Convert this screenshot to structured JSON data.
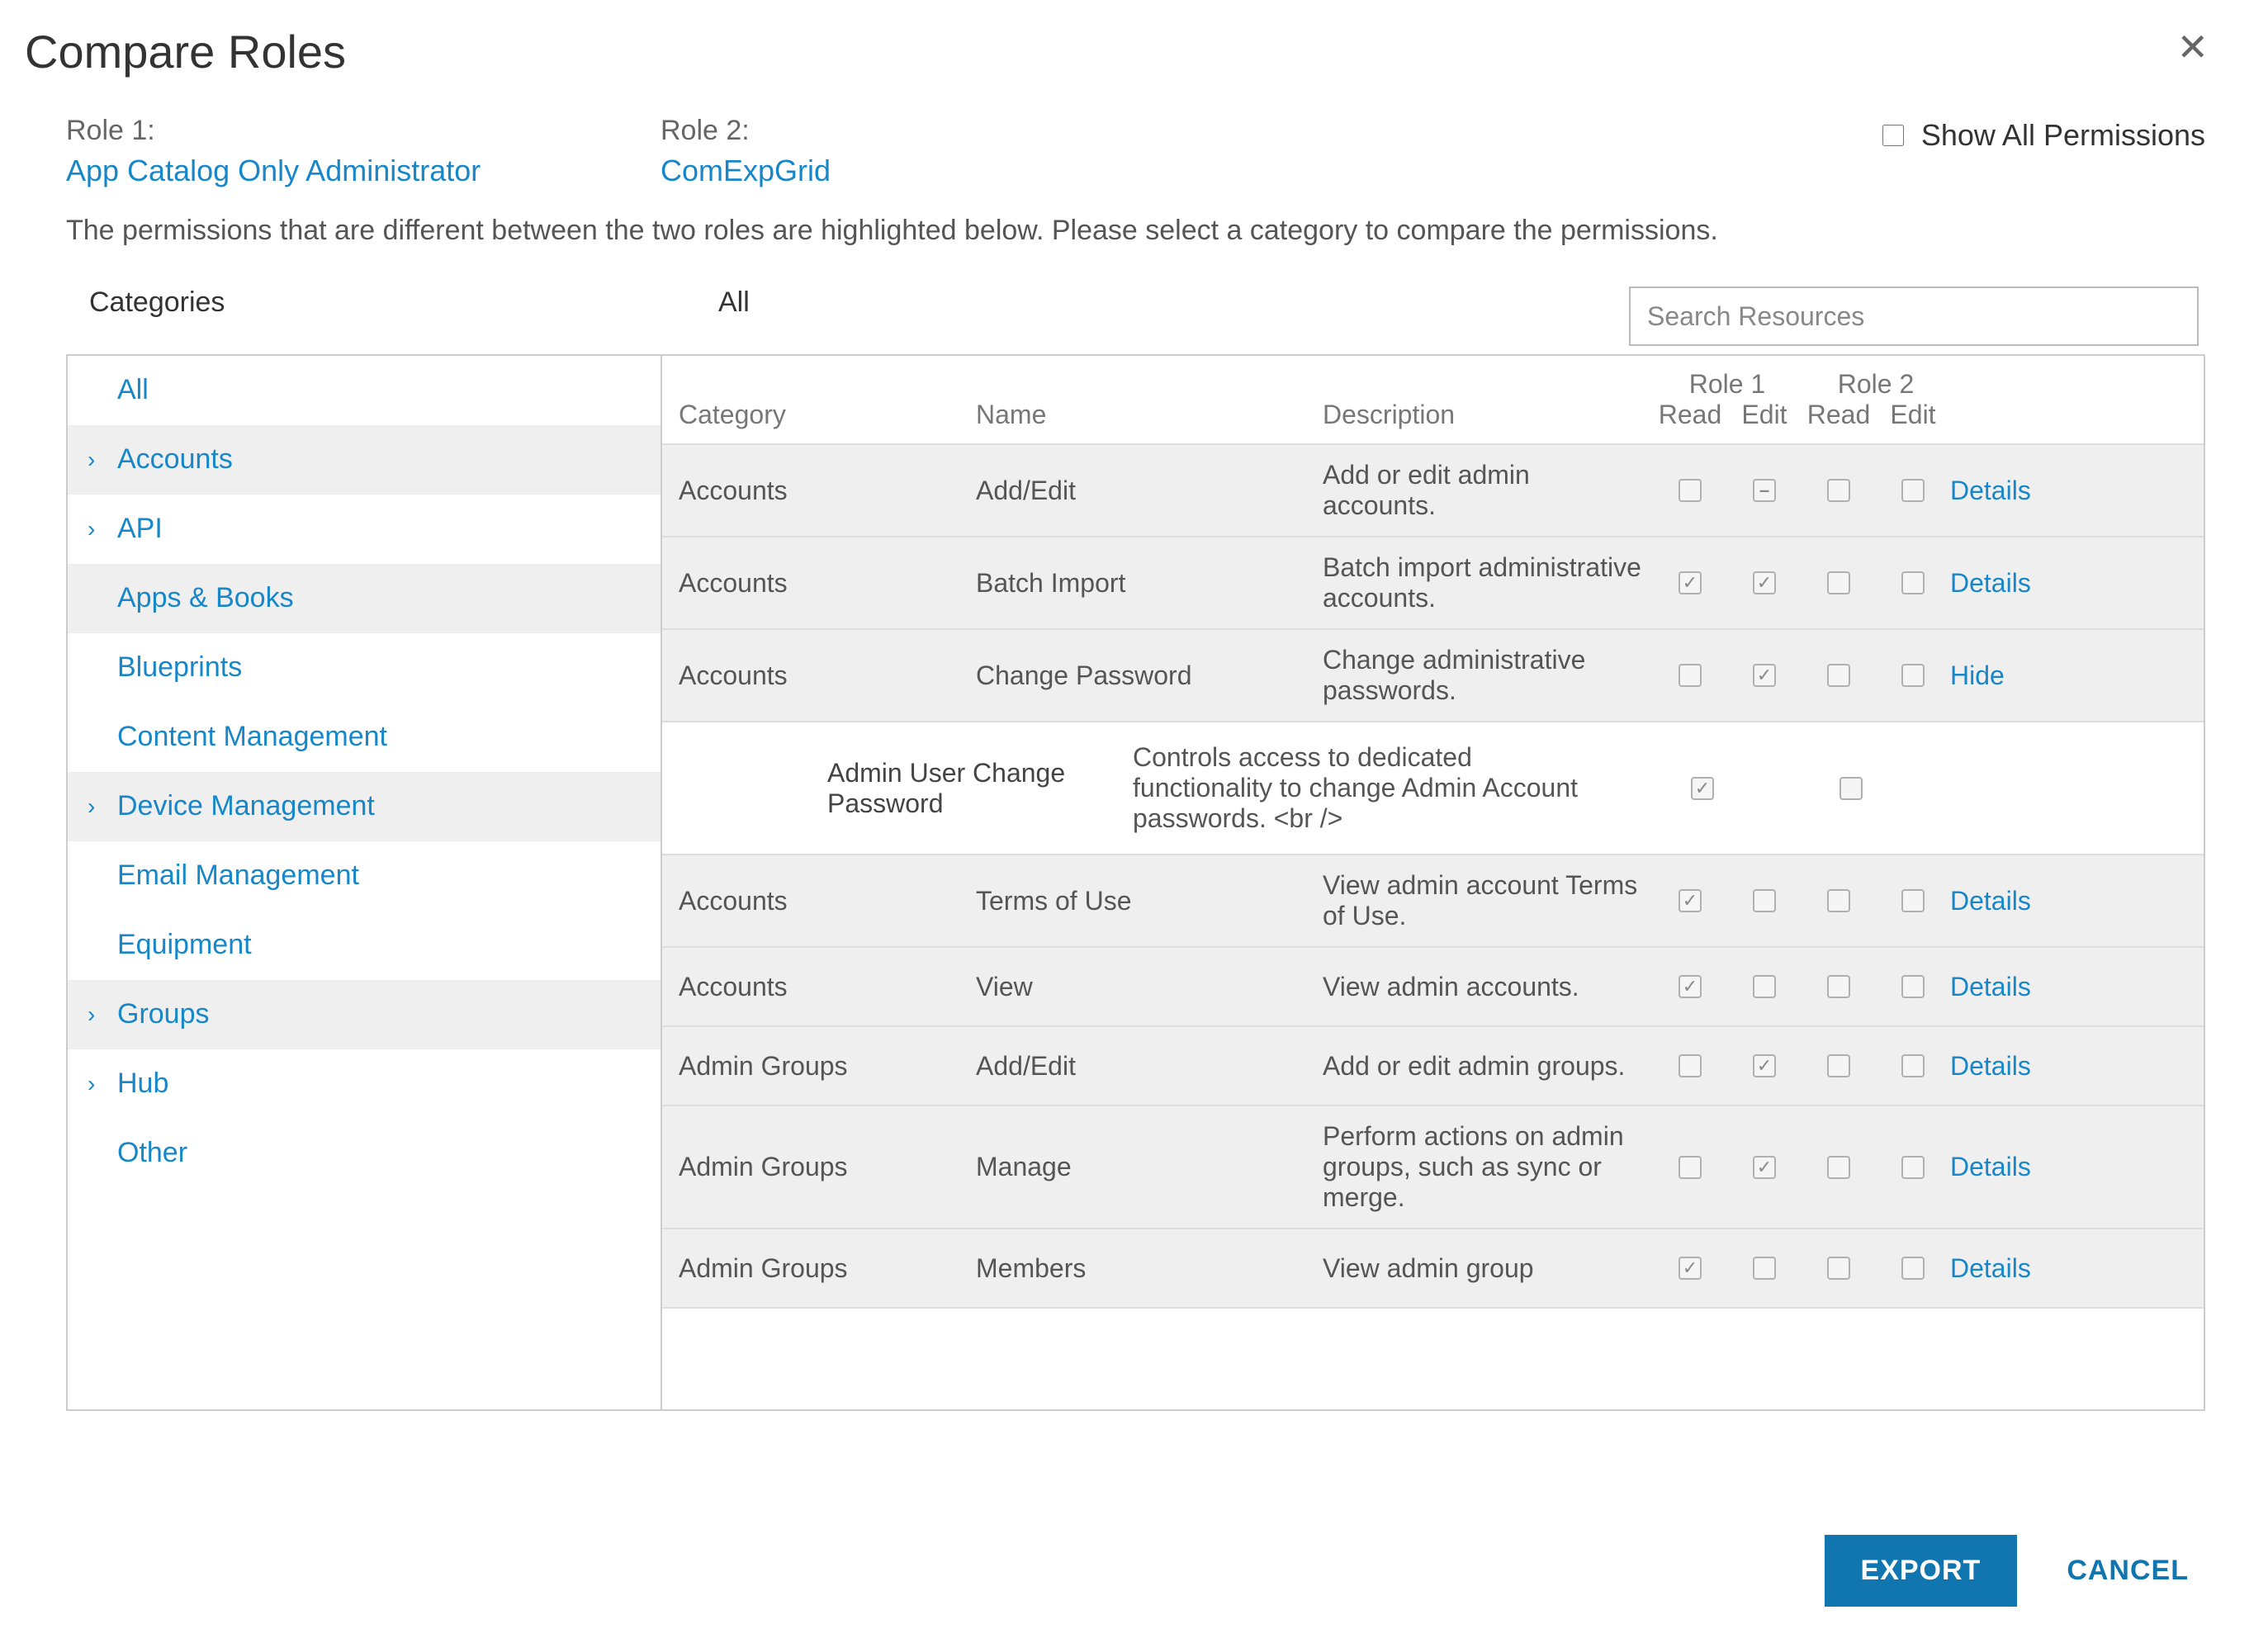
{
  "title": "Compare Roles",
  "role1": {
    "label": "Role 1:",
    "name": "App Catalog Only Administrator"
  },
  "role2": {
    "label": "Role 2:",
    "name": "ComExpGrid"
  },
  "showAll": {
    "label": "Show All Permissions",
    "checked": false
  },
  "instructions": "The permissions that are different between the two roles are highlighted below. Please select a category to compare the permissions.",
  "headers": {
    "categories": "Categories",
    "all": "All"
  },
  "search": {
    "placeholder": "Search Resources"
  },
  "sideItems": [
    {
      "label": "All",
      "caret": false,
      "alt": false
    },
    {
      "label": "Accounts",
      "caret": true,
      "alt": true
    },
    {
      "label": "API",
      "caret": true,
      "alt": false
    },
    {
      "label": "Apps & Books",
      "caret": false,
      "alt": true
    },
    {
      "label": "Blueprints",
      "caret": false,
      "alt": false
    },
    {
      "label": "Content Management",
      "caret": false,
      "alt": false
    },
    {
      "label": "Device Management",
      "caret": true,
      "alt": true
    },
    {
      "label": "Email Management",
      "caret": false,
      "alt": false
    },
    {
      "label": "Equipment",
      "caret": false,
      "alt": false
    },
    {
      "label": "Groups",
      "caret": true,
      "alt": true
    },
    {
      "label": "Hub",
      "caret": true,
      "alt": false
    },
    {
      "label": "Other",
      "caret": false,
      "alt": false
    }
  ],
  "thead": {
    "category": "Category",
    "name": "Name",
    "description": "Description",
    "role1": "Role 1",
    "role2": "Role 2",
    "read": "Read",
    "edit": "Edit"
  },
  "rows": [
    {
      "type": "row",
      "category": "Accounts",
      "name": "Add/Edit",
      "desc": "Add or edit admin accounts.",
      "r1read": "",
      "r1edit": "indet",
      "r2read": "",
      "r2edit": "",
      "action": "Details"
    },
    {
      "type": "row",
      "category": "Accounts",
      "name": "Batch Import",
      "desc": "Batch import administrative accounts.",
      "r1read": "checked",
      "r1edit": "checked",
      "r2read": "",
      "r2edit": "",
      "action": "Details"
    },
    {
      "type": "row",
      "category": "Accounts",
      "name": "Change Password",
      "desc": "Change administrative passwords.",
      "r1read": "",
      "r1edit": "checked",
      "r2read": "",
      "r2edit": "",
      "action": "Hide"
    },
    {
      "type": "sub",
      "name": "Admin User Change Password",
      "desc": "Controls access to dedicated functionality to change Admin Account passwords. <br />",
      "c1": "checked",
      "c2": ""
    },
    {
      "type": "row",
      "category": "Accounts",
      "name": "Terms of Use",
      "desc": "View admin account Terms of Use.",
      "r1read": "checked",
      "r1edit": "",
      "r2read": "",
      "r2edit": "",
      "action": "Details"
    },
    {
      "type": "row",
      "category": "Accounts",
      "name": "View",
      "desc": "View admin accounts.",
      "r1read": "checked",
      "r1edit": "",
      "r2read": "",
      "r2edit": "",
      "action": "Details"
    },
    {
      "type": "row",
      "category": "Admin Groups",
      "name": "Add/Edit",
      "desc": "Add or edit admin groups.",
      "r1read": "",
      "r1edit": "checked",
      "r2read": "",
      "r2edit": "",
      "action": "Details"
    },
    {
      "type": "row",
      "category": "Admin Groups",
      "name": "Manage",
      "desc": "Perform actions on admin groups, such as sync or merge.",
      "r1read": "",
      "r1edit": "checked",
      "r2read": "",
      "r2edit": "",
      "action": "Details"
    },
    {
      "type": "row",
      "category": "Admin Groups",
      "name": "Members",
      "desc": "View admin group",
      "r1read": "checked",
      "r1edit": "",
      "r2read": "",
      "r2edit": "",
      "action": "Details"
    }
  ],
  "footer": {
    "export": "EXPORT",
    "cancel": "CANCEL"
  }
}
